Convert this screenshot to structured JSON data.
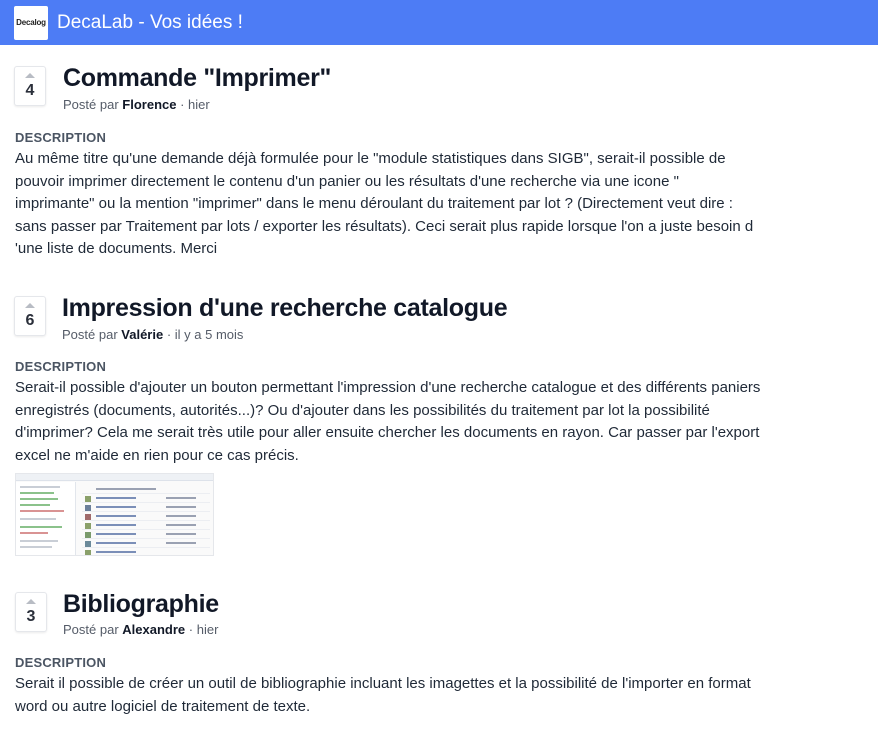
{
  "header": {
    "logo_text": "Decalog",
    "title": "DecaLab - Vos idées !"
  },
  "ideas": [
    {
      "votes": "4",
      "title": "Commande \"Imprimer\"",
      "posted_by_label": "Posté par",
      "author": "Florence",
      "when": "· hier",
      "description_label": "DESCRIPTION",
      "description_lines": [
        "Au même titre qu'une demande déjà formulée pour le \"module statistiques dans SIGB\", serait-il possible de",
        "pouvoir imprimer directement le contenu d'un panier ou les résultats d'une recherche via une icone \"",
        "imprimante\" ou la mention \"imprimer\" dans le menu déroulant du traitement par lot ? (Directement veut dire :",
        "sans passer par Traitement par lots / exporter les résultats). Ceci serait plus rapide lorsque l'on a juste besoin d",
        "'une liste de documents. Merci"
      ]
    },
    {
      "votes": "6",
      "title": "Impression d'une recherche catalogue",
      "posted_by_label": "Posté par",
      "author": "Valérie",
      "when": "· il y a 5 mois",
      "description_label": "DESCRIPTION",
      "description_lines": [
        "Serait-il possible d'ajouter un bouton permettant l'impression d'une recherche catalogue et des différents paniers",
        "enregistrés (documents, autorités...)? Ou d'ajouter dans les possibilités du traitement par lot la possibilité",
        "d'imprimer? Cela me serait très utile pour aller ensuite chercher les documents en rayon. Car passer par l'export",
        "excel ne m'aide en rien pour ce cas précis."
      ]
    },
    {
      "votes": "3",
      "title": "Bibliographie",
      "posted_by_label": "Posté par",
      "author": "Alexandre",
      "when": "· hier",
      "description_label": "DESCRIPTION",
      "description_lines": [
        "Serait il possible de créer un outil de bibliographie incluant les imagettes et la possibilité de l'importer en format",
        "word ou autre logiciel de traitement de texte."
      ]
    }
  ]
}
